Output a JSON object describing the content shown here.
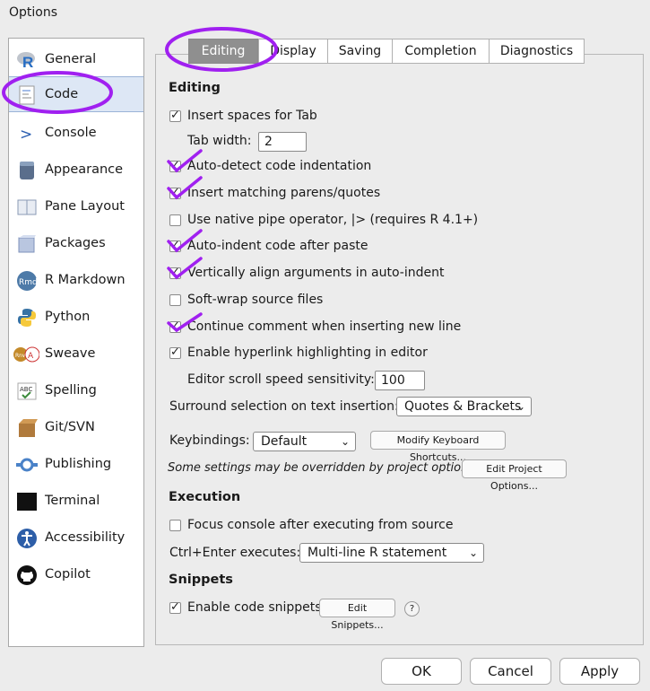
{
  "window": {
    "title": "Options"
  },
  "sidebar": {
    "items": [
      {
        "label": "General",
        "icon": "r-logo-icon"
      },
      {
        "label": "Code",
        "icon": "code-document-icon"
      },
      {
        "label": "Console",
        "icon": "console-prompt-icon"
      },
      {
        "label": "Appearance",
        "icon": "appearance-jar-icon"
      },
      {
        "label": "Pane Layout",
        "icon": "pane-layout-icon"
      },
      {
        "label": "Packages",
        "icon": "packages-box-icon"
      },
      {
        "label": "R Markdown",
        "icon": "rmd-icon"
      },
      {
        "label": "Python",
        "icon": "python-icon"
      },
      {
        "label": "Sweave",
        "icon": "sweave-icon"
      },
      {
        "label": "Spelling",
        "icon": "spelling-abc-icon"
      },
      {
        "label": "Git/SVN",
        "icon": "git-box-icon"
      },
      {
        "label": "Publishing",
        "icon": "publishing-icon"
      },
      {
        "label": "Terminal",
        "icon": "terminal-icon"
      },
      {
        "label": "Accessibility",
        "icon": "accessibility-icon"
      },
      {
        "label": "Copilot",
        "icon": "github-icon"
      }
    ],
    "selected": "Code"
  },
  "tabs": [
    "Editing",
    "Display",
    "Saving",
    "Completion",
    "Diagnostics"
  ],
  "editing": {
    "section_title": "Editing",
    "insert_spaces": "Insert spaces for Tab",
    "tab_width_label": "Tab width:",
    "tab_width_value": "2",
    "auto_detect": "Auto-detect code indentation",
    "insert_matching": "Insert matching parens/quotes",
    "native_pipe": "Use native pipe operator, |> (requires R 4.1+)",
    "auto_indent": "Auto-indent code after paste",
    "vertical_align": "Vertically align arguments in auto-indent",
    "soft_wrap": "Soft-wrap source files",
    "continue_comment": "Continue comment when inserting new line",
    "hyperlink": "Enable hyperlink highlighting in editor",
    "scroll_label": "Editor scroll speed sensitivity:",
    "scroll_value": "100",
    "surround_label": "Surround selection on text insertion:",
    "surround_value": "Quotes & Brackets",
    "keybindings_label": "Keybindings:",
    "keybindings_value": "Default",
    "modify_shortcuts": "Modify Keyboard Shortcuts...",
    "project_note": "Some settings may be overridden by project options.",
    "edit_project_options": "Edit Project Options..."
  },
  "execution": {
    "section_title": "Execution",
    "focus_console": "Focus console after executing from source",
    "ctrl_enter_label": "Ctrl+Enter executes:",
    "ctrl_enter_value": "Multi-line R statement"
  },
  "snippets": {
    "section_title": "Snippets",
    "enable": "Enable code snippets",
    "edit_button": "Edit Snippets...",
    "help": "?"
  },
  "footer": {
    "ok": "OK",
    "cancel": "Cancel",
    "apply": "Apply"
  },
  "checkbox_states": {
    "insert_spaces": true,
    "auto_detect": true,
    "insert_matching": true,
    "native_pipe": false,
    "auto_indent": true,
    "vertical_align": true,
    "soft_wrap": false,
    "continue_comment": true,
    "hyperlink": true,
    "focus_console": false,
    "snippets": true
  },
  "colors": {
    "annotation": "#a020f0",
    "selected_tab": "#8f8f8f",
    "selected_side": "#dde7f5"
  }
}
